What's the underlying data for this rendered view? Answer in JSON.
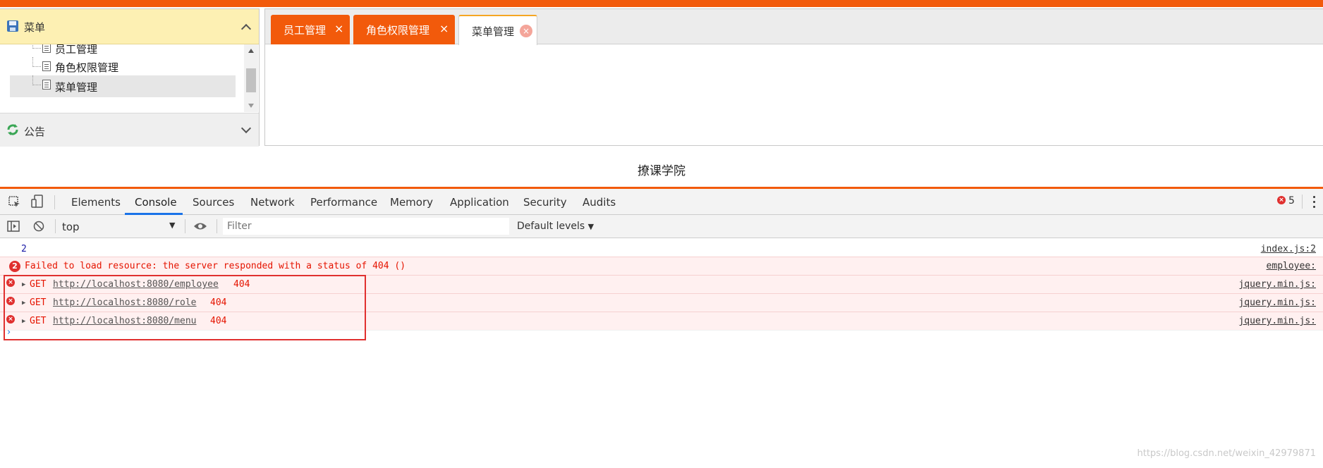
{
  "app": {
    "sidebar": {
      "menu_title": "菜单",
      "tree_items": [
        "员工管理",
        "角色权限管理",
        "菜单管理"
      ],
      "selected_item": "菜单管理",
      "notice_title": "公告"
    },
    "tabs": [
      {
        "label": "员工管理",
        "close": "×"
      },
      {
        "label": "角色权限管理",
        "close": "×"
      },
      {
        "label": "菜单管理",
        "close": "×"
      }
    ],
    "footer_text": "撩课学院"
  },
  "devtools": {
    "tabs": [
      "Elements",
      "Console",
      "Sources",
      "Network",
      "Performance",
      "Memory",
      "Application",
      "Security",
      "Audits"
    ],
    "active_tab": "Console",
    "error_count": "5",
    "context": "top",
    "filter_placeholder": "Filter",
    "levels_label": "Default levels",
    "levels_arrow": "▼",
    "context_arrow": "▼",
    "prompt": "›",
    "console": {
      "log": {
        "text": "2",
        "source": "index.js:2"
      },
      "resource_error": {
        "count": "2",
        "text": "Failed to load resource: the server responded with a status of 404 ()",
        "source": "employee:"
      },
      "requests": [
        {
          "method": "GET",
          "url": "http://localhost:8080/employee",
          "status": "404",
          "source": "jquery.min.js:"
        },
        {
          "method": "GET",
          "url": "http://localhost:8080/role",
          "status": "404",
          "source": "jquery.min.js:"
        },
        {
          "method": "GET",
          "url": "http://localhost:8080/menu",
          "status": "404",
          "source": "jquery.min.js:"
        }
      ]
    }
  },
  "watermark": "https://blog.csdn.net/weixin_42979871",
  "colors": {
    "accent": "#f25a0b",
    "menu_header": "#fdf0b3",
    "error": "#e0302f",
    "devtools_active": "#1a73e8"
  },
  "icons": [
    "save-icon",
    "chevron-up-icon",
    "document-icon",
    "refresh-icon",
    "chevron-down-icon",
    "close-icon",
    "inspect-icon",
    "device-toggle-icon",
    "sidebar-toggle-icon",
    "clear-console-icon",
    "eye-icon",
    "kebab-menu-icon",
    "error-icon",
    "expand-triangle-icon"
  ]
}
